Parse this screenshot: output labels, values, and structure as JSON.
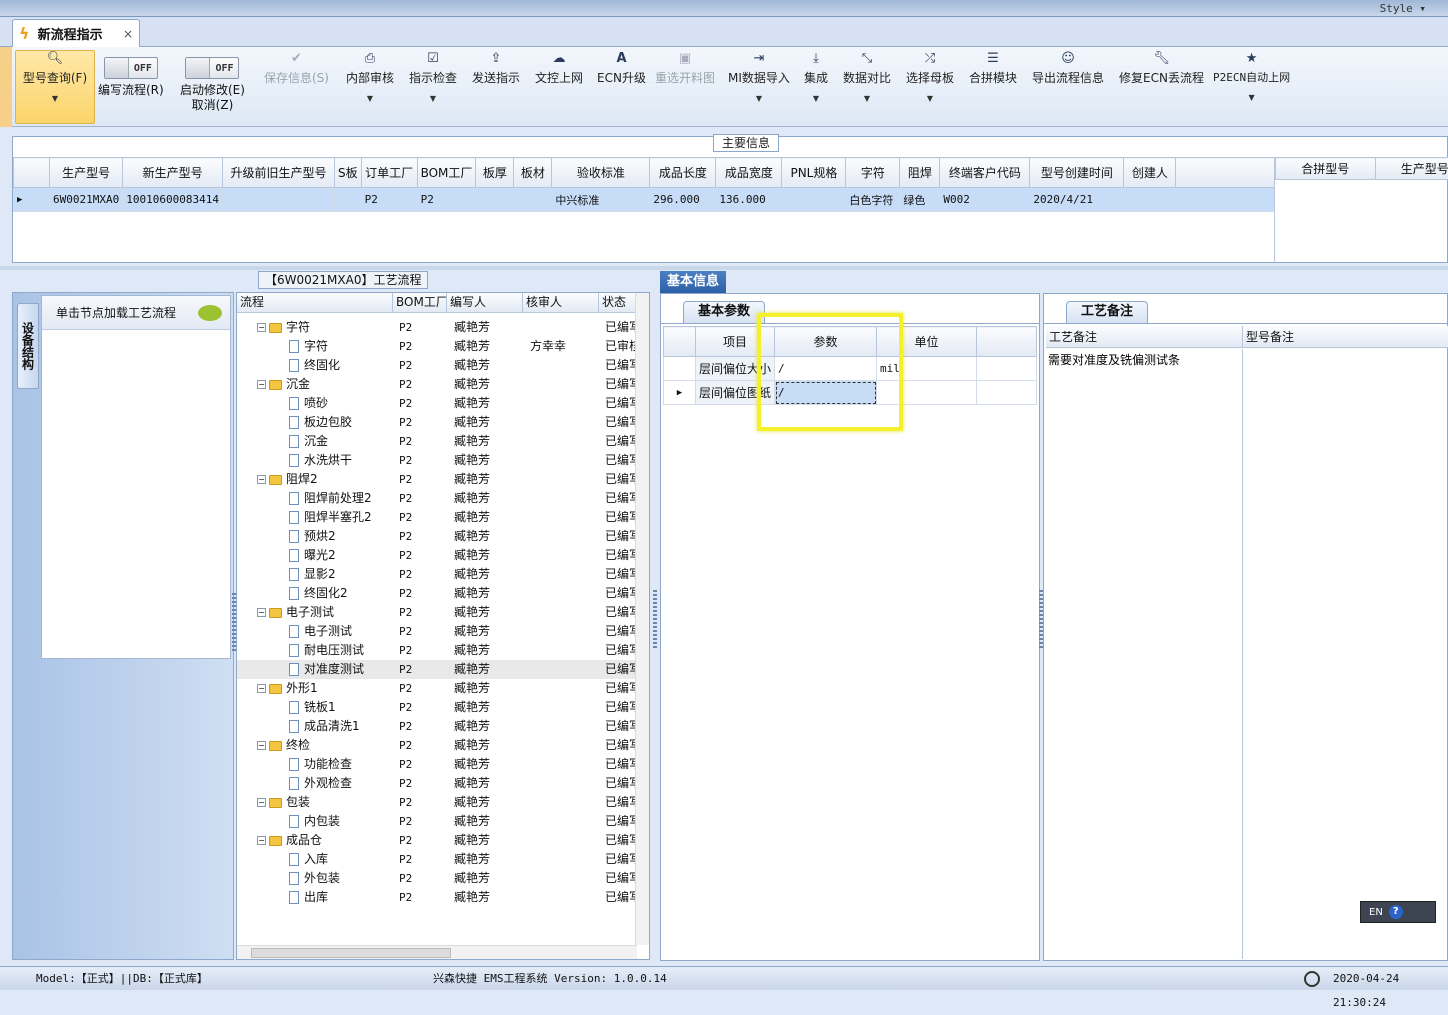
{
  "top": {
    "style_label": "Style ▾"
  },
  "tab": {
    "title": "新流程指示",
    "close": "×"
  },
  "toolbar": {
    "query": "型号查询(F)",
    "write_flow_toggle": "OFF",
    "write_flow": "编写流程(R)",
    "start_modify_toggle": "OFF",
    "start_modify": "启动修改(E)",
    "cancel": "取消(Z)",
    "buttons": [
      "保存信息(S)",
      "内部审核",
      "指示检查",
      "发送指示",
      "文控上网",
      "ECN升级",
      "重选开料图",
      "MI数据导入",
      "集成",
      "数据对比",
      "选择母板",
      "合拼模块",
      "导出流程信息",
      "修复ECN丢流程",
      "P2ECN自动上网"
    ]
  },
  "main_info": {
    "label": "主要信息",
    "columns": [
      "生产型号",
      "新生产型号",
      "升级前旧生产型号",
      "S板",
      "订单工厂",
      "BOM工厂",
      "板厚",
      "板材",
      "验收标准",
      "成品长度",
      "成品宽度",
      "PNL规格",
      "字符",
      "阻焊",
      "终端客户代码",
      "型号创建时间",
      "创建人"
    ],
    "row": [
      "6W0021MXA0",
      "10010600083414",
      "",
      "",
      "P2",
      "P2",
      "",
      "",
      "中兴标准",
      "296.000",
      "136.000",
      "",
      "白色字符",
      "绿色",
      "W002",
      "2020/4/21",
      ""
    ],
    "side_columns": [
      "合拼型号",
      "生产型号"
    ]
  },
  "left": {
    "vtab": "设备结构",
    "header": "单击节点加载工艺流程"
  },
  "tree": {
    "label": "【6W0021MXA0】工艺流程",
    "columns": [
      "流程",
      "BOM工厂",
      "编写人",
      "核审人",
      "状态"
    ],
    "rows": [
      {
        "name": "字符",
        "lvl": 0,
        "f": "P2",
        "w": "臧艳芳",
        "r": "",
        "s": "已编写"
      },
      {
        "name": "字符",
        "lvl": 1,
        "f": "P2",
        "w": "臧艳芳",
        "r": "方幸幸",
        "s": "已审核"
      },
      {
        "name": "终固化",
        "lvl": 1,
        "f": "P2",
        "w": "臧艳芳",
        "r": "",
        "s": "已编写"
      },
      {
        "name": "沉金",
        "lvl": 0,
        "f": "P2",
        "w": "臧艳芳",
        "r": "",
        "s": "已编写"
      },
      {
        "name": "喷砂",
        "lvl": 1,
        "f": "P2",
        "w": "臧艳芳",
        "r": "",
        "s": "已编写"
      },
      {
        "name": "板边包胶",
        "lvl": 1,
        "f": "P2",
        "w": "臧艳芳",
        "r": "",
        "s": "已编写"
      },
      {
        "name": "沉金",
        "lvl": 1,
        "f": "P2",
        "w": "臧艳芳",
        "r": "",
        "s": "已编写"
      },
      {
        "name": "水洗烘干",
        "lvl": 1,
        "f": "P2",
        "w": "臧艳芳",
        "r": "",
        "s": "已编写"
      },
      {
        "name": "阻焊2",
        "lvl": 0,
        "f": "P2",
        "w": "臧艳芳",
        "r": "",
        "s": "已编写"
      },
      {
        "name": "阻焊前处理2",
        "lvl": 1,
        "f": "P2",
        "w": "臧艳芳",
        "r": "",
        "s": "已编写"
      },
      {
        "name": "阻焊半塞孔2",
        "lvl": 1,
        "f": "P2",
        "w": "臧艳芳",
        "r": "",
        "s": "已编写"
      },
      {
        "name": "预烘2",
        "lvl": 1,
        "f": "P2",
        "w": "臧艳芳",
        "r": "",
        "s": "已编写"
      },
      {
        "name": "曝光2",
        "lvl": 1,
        "f": "P2",
        "w": "臧艳芳",
        "r": "",
        "s": "已编写"
      },
      {
        "name": "显影2",
        "lvl": 1,
        "f": "P2",
        "w": "臧艳芳",
        "r": "",
        "s": "已编写"
      },
      {
        "name": "终固化2",
        "lvl": 1,
        "f": "P2",
        "w": "臧艳芳",
        "r": "",
        "s": "已编写"
      },
      {
        "name": "电子测试",
        "lvl": 0,
        "f": "P2",
        "w": "臧艳芳",
        "r": "",
        "s": "已编写"
      },
      {
        "name": "电子测试",
        "lvl": 1,
        "f": "P2",
        "w": "臧艳芳",
        "r": "",
        "s": "已编写"
      },
      {
        "name": "耐电压测试",
        "lvl": 1,
        "f": "P2",
        "w": "臧艳芳",
        "r": "",
        "s": "已编写"
      },
      {
        "name": "对准度测试",
        "lvl": 1,
        "f": "P2",
        "w": "臧艳芳",
        "r": "",
        "s": "已编写",
        "sel": true
      },
      {
        "name": "外形1",
        "lvl": 0,
        "f": "P2",
        "w": "臧艳芳",
        "r": "",
        "s": "已编写"
      },
      {
        "name": "铣板1",
        "lvl": 1,
        "f": "P2",
        "w": "臧艳芳",
        "r": "",
        "s": "已编写"
      },
      {
        "name": "成品清洗1",
        "lvl": 1,
        "f": "P2",
        "w": "臧艳芳",
        "r": "",
        "s": "已编写"
      },
      {
        "name": "终检",
        "lvl": 0,
        "f": "P2",
        "w": "臧艳芳",
        "r": "",
        "s": "已编写"
      },
      {
        "name": "功能检查",
        "lvl": 1,
        "f": "P2",
        "w": "臧艳芳",
        "r": "",
        "s": "已编写"
      },
      {
        "name": "外观检查",
        "lvl": 1,
        "f": "P2",
        "w": "臧艳芳",
        "r": "",
        "s": "已编写"
      },
      {
        "name": "包装",
        "lvl": 0,
        "f": "P2",
        "w": "臧艳芳",
        "r": "",
        "s": "已编写"
      },
      {
        "name": "内包装",
        "lvl": 1,
        "f": "P2",
        "w": "臧艳芳",
        "r": "",
        "s": "已编写"
      },
      {
        "name": "成品仓",
        "lvl": 0,
        "f": "P2",
        "w": "臧艳芳",
        "r": "",
        "s": "已编写"
      },
      {
        "name": "入库",
        "lvl": 1,
        "f": "P2",
        "w": "臧艳芳",
        "r": "",
        "s": "已编写"
      },
      {
        "name": "外包装",
        "lvl": 1,
        "f": "P2",
        "w": "臧艳芳",
        "r": "",
        "s": "已编写"
      },
      {
        "name": "出库",
        "lvl": 1,
        "f": "P2",
        "w": "臧艳芳",
        "r": "",
        "s": "已编写"
      }
    ]
  },
  "info": {
    "tab": "基本信息",
    "subtab": "基本参数",
    "columns": [
      "项目",
      "参数",
      "单位"
    ],
    "rows": [
      {
        "item": "层间偏位大小",
        "param": "/",
        "unit": "mil"
      },
      {
        "item": "层间偏位图纸",
        "param": "/",
        "unit": ""
      }
    ]
  },
  "notes": {
    "tab": "工艺备注",
    "col1": "工艺备注",
    "col2": "型号备注",
    "text": "需要对准度及铣偏测试条"
  },
  "status": {
    "left": "Model:【正式】||DB:【正式库】",
    "center": "兴森快捷 EMS工程系统 Version: 1.0.0.14",
    "time": "2020-04-24 21:30:24"
  },
  "ime": {
    "lang": "EN",
    "help": "?"
  }
}
